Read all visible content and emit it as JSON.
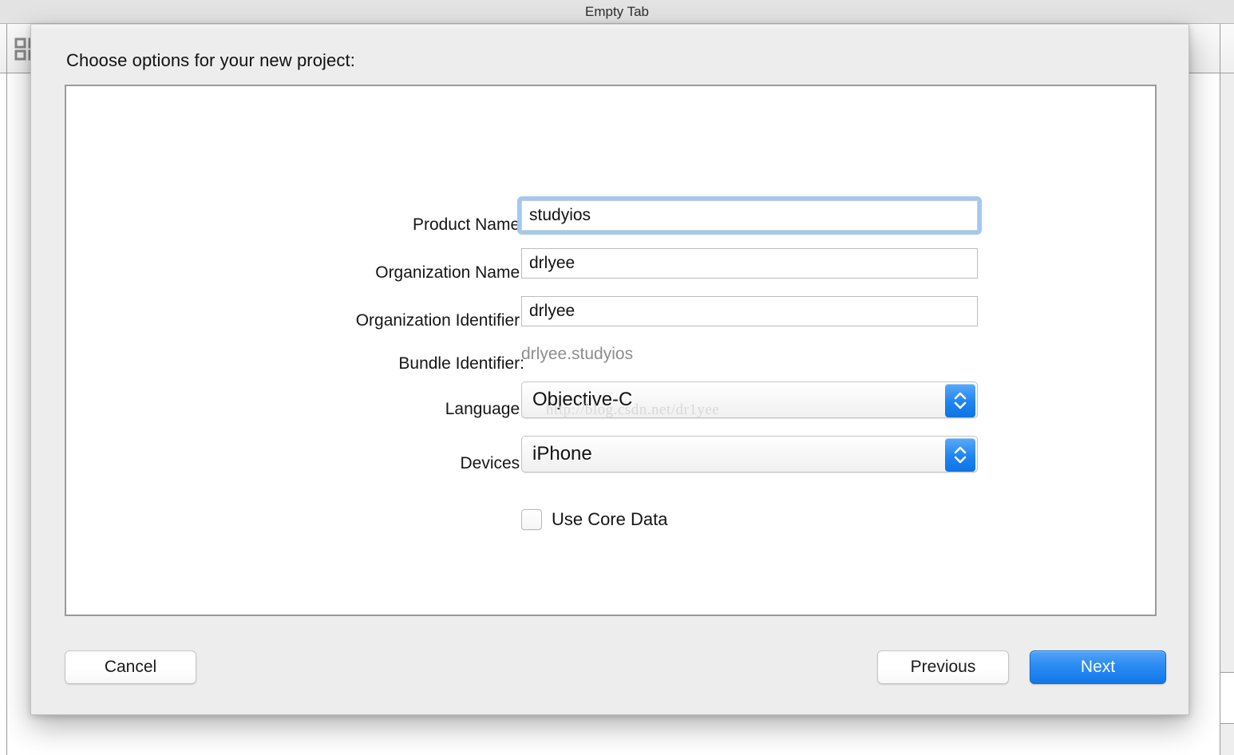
{
  "background_window": {
    "tab_title": "Empty Tab",
    "toolbar_icon": "project-navigator-icon"
  },
  "dialog": {
    "heading": "Choose options for your new project:",
    "watermark": "http://blog.csdn.net/dr1yee",
    "fields": [
      {
        "label": "Product Name:",
        "value": "studyios",
        "type": "text",
        "focused": true,
        "placeholder": ""
      },
      {
        "label": "Organization Name:",
        "value": "drlyee",
        "type": "text",
        "focused": false,
        "placeholder": ""
      },
      {
        "label": "Organization Identifier:",
        "value": "drlyee",
        "type": "text",
        "focused": false,
        "placeholder": ""
      },
      {
        "label": "Bundle Identifier:",
        "value": "drlyee.studyios",
        "type": "static",
        "focused": false,
        "placeholder": ""
      },
      {
        "label": "Language:",
        "value": "Objective-C",
        "type": "popup",
        "focused": false,
        "placeholder": ""
      },
      {
        "label": "Devices:",
        "value": "iPhone",
        "type": "popup",
        "focused": false,
        "placeholder": ""
      }
    ],
    "checkbox": {
      "label": "Use Core Data",
      "checked": false
    },
    "buttons": {
      "cancel": "Cancel",
      "previous": "Previous",
      "next": "Next"
    },
    "colors": {
      "accent": "#1e84f0",
      "focus_ring": "#a2c9f0",
      "sheet_bg": "#ededed",
      "static_text": "#8d8d8d"
    }
  }
}
